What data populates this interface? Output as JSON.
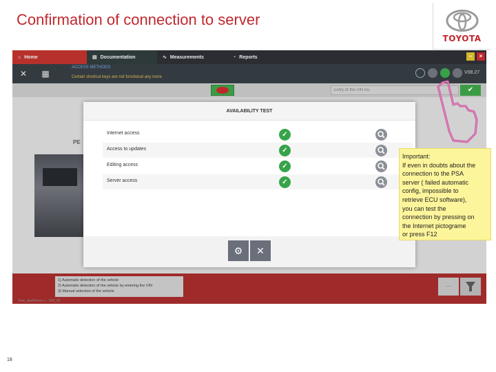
{
  "slide": {
    "title": "Confirmation of connection to server",
    "page_number": "18",
    "brand": "TOYOTA"
  },
  "app": {
    "tabs": [
      {
        "label": "Home"
      },
      {
        "label": "Documentation"
      },
      {
        "label": "Measurements"
      },
      {
        "label": "Reports"
      }
    ],
    "toolbar": {
      "text1": "ACCESS METHODS",
      "text2": "Certain shortcut keys are not functional any more.",
      "version": "V08.27"
    },
    "search": {
      "placeholder": "Entry of the VIN no.",
      "ok_icon": "check-icon"
    },
    "background": {
      "brand_text": "PE"
    },
    "options": [
      "1) Automatic detection of the vehicle",
      "2) Automatic detection of the vehicle by entering the VIN",
      "3) Manual selection of the vehicle"
    ],
    "footer_note": "Tree_startPerso v... 104_30"
  },
  "dialog": {
    "title": "AVAILABILITY TEST",
    "rows": [
      {
        "label": "Internet access",
        "status": "ok"
      },
      {
        "label": "Access to updates",
        "status": "ok"
      },
      {
        "label": "Editing access",
        "status": "ok"
      },
      {
        "label": "Server access",
        "status": "ok"
      }
    ],
    "buttons": [
      "settings-icon",
      "close-icon"
    ]
  },
  "callout": {
    "lines": [
      "Important:",
      "If even in doubts about the",
      "connection to the PSA",
      "server ( failed automatic",
      "config, impossible to",
      "retrieve ECU software),",
      "you can test the",
      "connection by pressing on",
      "the Internet pictograme",
      "or press  F12"
    ]
  },
  "colors": {
    "title_red": "#c0272d",
    "ok_green": "#37a349",
    "callout_yellow": "#fdf59b",
    "pointer_pink": "#c9509b"
  }
}
